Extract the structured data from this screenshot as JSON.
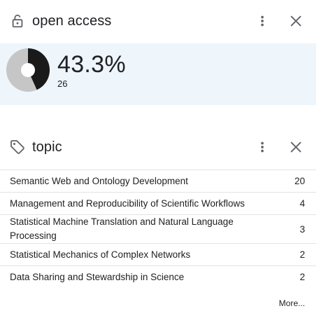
{
  "open_access": {
    "title": "open access",
    "percent": "43.3%",
    "count": "26",
    "fraction": 0.433,
    "colors": {
      "filled": "#1a1a1a",
      "remainder": "#c6c6c6",
      "background": "#eef5fb"
    },
    "icons": {
      "lead": "lock-open-icon",
      "menu": "more-vert-icon",
      "close": "close-icon"
    }
  },
  "topic": {
    "title": "topic",
    "icons": {
      "lead": "tag-icon",
      "menu": "more-vert-icon",
      "close": "close-icon"
    },
    "items": [
      {
        "label": "Semantic Web and Ontology Development",
        "count": "20"
      },
      {
        "label": "Management and Reproducibility of Scientific Workflows",
        "count": "4"
      },
      {
        "label": "Statistical Machine Translation and Natural Language Processing",
        "count": "3"
      },
      {
        "label": "Statistical Mechanics of Complex Networks",
        "count": "2"
      },
      {
        "label": "Data Sharing and Stewardship in Science",
        "count": "2"
      }
    ],
    "more_label": "More..."
  }
}
